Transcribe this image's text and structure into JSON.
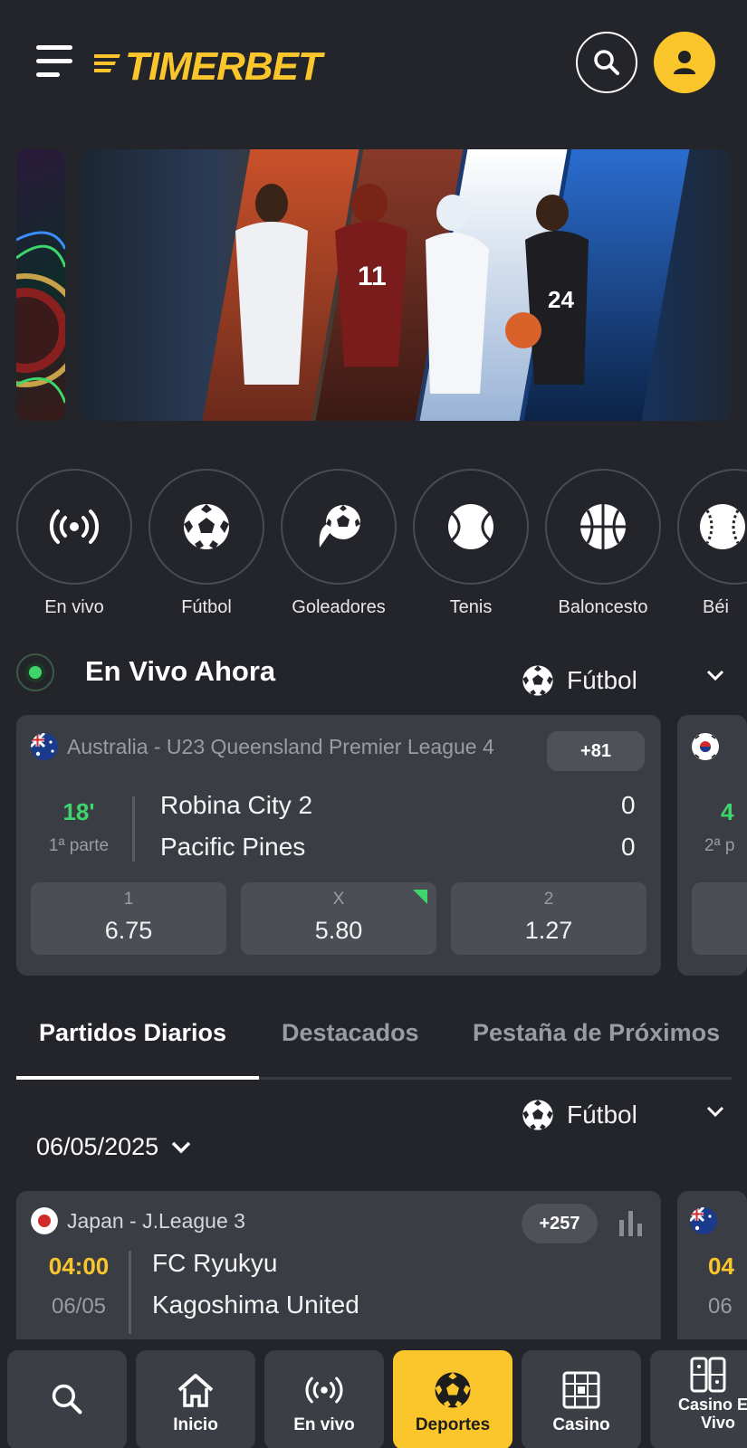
{
  "header": {
    "logo_text": "TIMERBET",
    "brand_color": "#fbc62b",
    "icons": [
      "menu-icon",
      "search-icon",
      "user-icon"
    ]
  },
  "sports": [
    {
      "label": "En vivo",
      "icon": "live-signal-icon"
    },
    {
      "label": "Fútbol",
      "icon": "soccer-ball-icon"
    },
    {
      "label": "Goleadores",
      "icon": "scorer-icon"
    },
    {
      "label": "Tenis",
      "icon": "tennis-ball-icon"
    },
    {
      "label": "Baloncesto",
      "icon": "basketball-icon"
    },
    {
      "label": "Béi",
      "icon": "baseball-icon"
    }
  ],
  "live": {
    "title": "En Vivo Ahora",
    "sport_filter": "Fútbol",
    "match": {
      "league": "Australia - U23 Queensland Premier League 4",
      "more_markets": "+81",
      "minute": "18'",
      "period": "1ª parte",
      "home": "Robina City 2",
      "away": "Pacific Pines",
      "home_score": "0",
      "away_score": "0",
      "odds": [
        {
          "label": "1",
          "value": "6.75"
        },
        {
          "label": "X",
          "value": "5.80"
        },
        {
          "label": "2",
          "value": "1.27"
        }
      ]
    },
    "next_match_peek": {
      "minute": "4",
      "period": "2ª p"
    }
  },
  "tabs": [
    "Partidos Diarios",
    "Destacados",
    "Pestaña de Próximos"
  ],
  "daily": {
    "sport_filter": "Fútbol",
    "date": "06/05/2025",
    "match": {
      "league": "Japan - J.League 3",
      "more_markets": "+257",
      "time": "04:00",
      "date": "06/05",
      "home": "FC Ryukyu",
      "away": "Kagoshima United"
    },
    "next_match_peek": {
      "time": "04",
      "date": "06"
    }
  },
  "bottom_nav": [
    {
      "label": "",
      "icon": "search-icon"
    },
    {
      "label": "Inicio",
      "icon": "home-icon"
    },
    {
      "label": "En vivo",
      "icon": "live-signal-icon"
    },
    {
      "label": "Deportes",
      "icon": "soccer-ball-icon",
      "active": true
    },
    {
      "label": "Casino",
      "icon": "slot-icon"
    },
    {
      "label": "Casino En Vivo",
      "icon": "dominoes-icon"
    }
  ]
}
